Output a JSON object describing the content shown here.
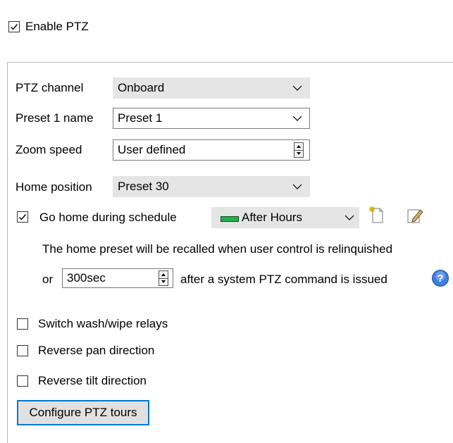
{
  "enable_ptz": {
    "label": "Enable PTZ",
    "checked": true
  },
  "ptz_channel": {
    "label": "PTZ channel",
    "value": "Onboard"
  },
  "preset_name": {
    "label": "Preset 1 name",
    "value": "Preset 1"
  },
  "zoom_speed": {
    "label": "Zoom speed",
    "value": "User defined"
  },
  "home_position": {
    "label": "Home position",
    "value": "Preset 30"
  },
  "go_home": {
    "label": "Go home during schedule",
    "checked": true,
    "schedule_value": "After Hours",
    "schedule_color": "#22b14c",
    "info_line1": "The home preset will be recalled when user control is relinquished",
    "or_label": "or",
    "timeout_value": "300sec",
    "info_line2": "after a system PTZ command is issued",
    "icons": [
      "new-schedule-icon",
      "edit-schedule-icon",
      "help-icon"
    ]
  },
  "options": [
    {
      "label": "Switch wash/wipe relays",
      "checked": false
    },
    {
      "label": "Reverse pan direction",
      "checked": false
    },
    {
      "label": "Reverse tilt direction",
      "checked": false
    }
  ],
  "configure_button": "Configure PTZ tours",
  "accent_color": "#0078d7",
  "help_color": "#3e7fe0"
}
